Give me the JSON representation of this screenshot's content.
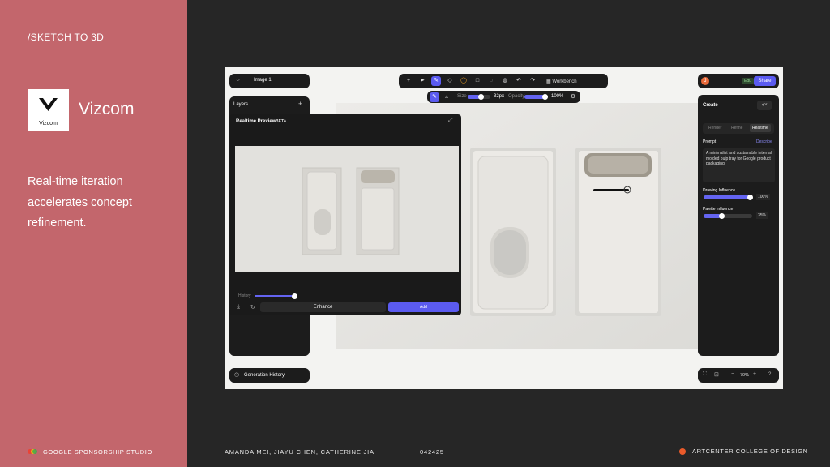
{
  "slide": {
    "section": "/SKETCH TO 3D",
    "logo_small": "Vizcom",
    "brand": "Vizcom",
    "tagline": "Real-time iteration accelerates concept refinement.",
    "sponsor": "GOOGLE SPONSORSHIP STUDIO",
    "authors": "AMANDA MEI, JIAYU CHEN, CATHERINE JIA",
    "date": "042425",
    "college": "ARTCENTER COLLEGE OF DESIGN",
    "colors": {
      "left_panel": "#c3666c",
      "background": "#262626",
      "accent": "#5b5bf0",
      "college_dot": "#ea5a2a"
    }
  },
  "app": {
    "file_name": "Image 1",
    "workbench": "Workbench",
    "toolbar_icons": [
      "plus-icon",
      "select-arrow-icon",
      "brush-icon",
      "eraser-icon",
      "color-ring-icon",
      "rectangle-icon",
      "lasso-icon",
      "mask-icon",
      "undo-icon",
      "redo-icon",
      "workbench-icon"
    ],
    "brush": {
      "size_label": "Size",
      "size_value": "32px",
      "size_fraction": 0.55,
      "opacity_label": "Opacity",
      "opacity_value": "100%",
      "opacity_fraction": 1.0
    },
    "layers": {
      "title": "Layers",
      "add": "+"
    },
    "preview": {
      "title": "Realtime Preview",
      "badge": "BETA",
      "history_label": "History",
      "history_fraction": 1.0,
      "enhance": "Enhance",
      "add": "Add"
    },
    "generation_history": "Generation History",
    "edu_badge": "Edu",
    "share": "Share",
    "avatar": "J",
    "create": {
      "title": "Create",
      "tabs": [
        "Render",
        "Refine",
        "Realtime"
      ],
      "active_tab": "Realtime",
      "prompt_label": "Prompt",
      "describe": "Describe",
      "prompt_text": "A minimalist and sustainable internal molded pulp tray for Google product packaging",
      "drawing_influence_label": "Drawing Influence",
      "drawing_influence_value": "100%",
      "drawing_influence_fraction": 1.0,
      "palette_influence_label": "Palette Influence",
      "palette_influence_value": "35%",
      "palette_influence_fraction": 0.35
    },
    "zoom": "70%",
    "help": "?"
  }
}
